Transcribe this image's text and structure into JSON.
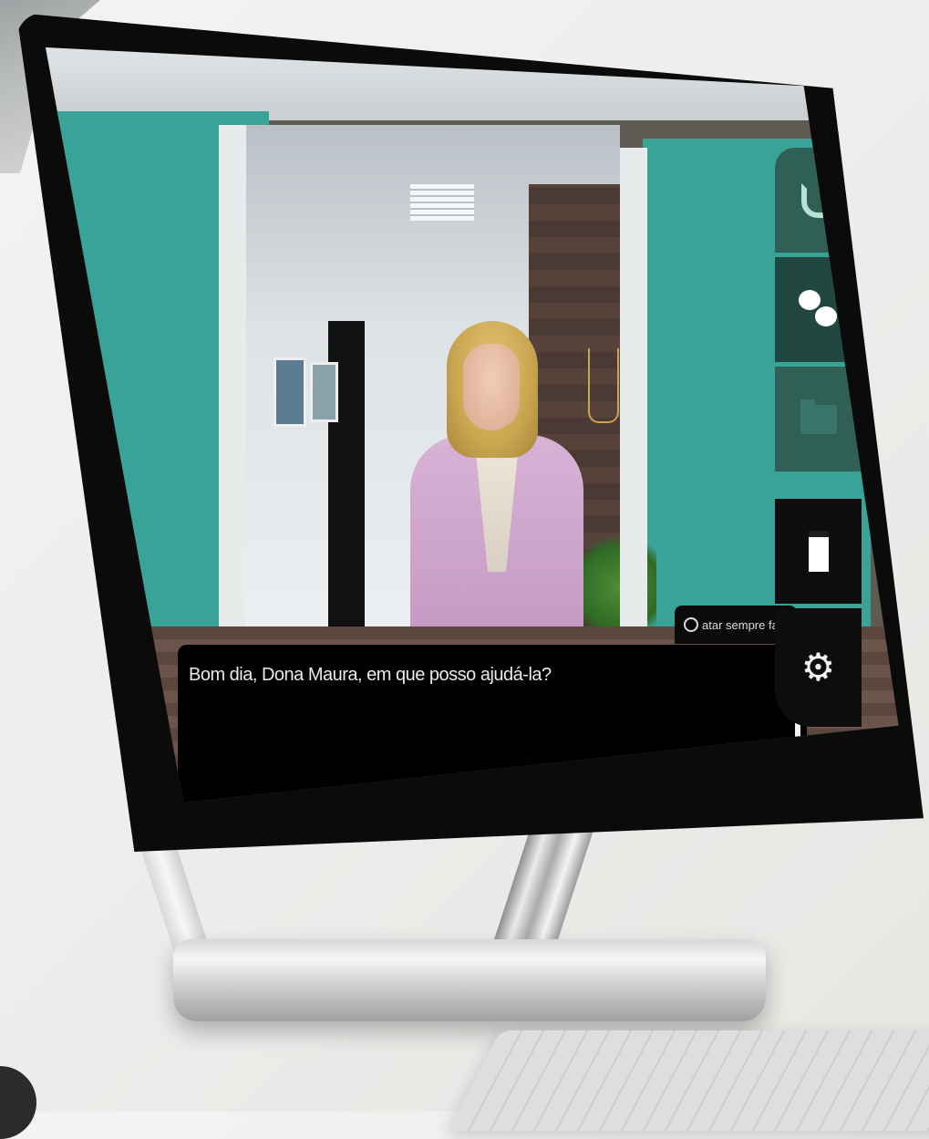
{
  "dialogue": {
    "text": "Bom dia, Dona Maura, em que posso ajudá-la?",
    "speaker_tag": "atar sempre fala"
  },
  "toolbar": {
    "buttons": [
      {
        "icon": "phone-icon"
      },
      {
        "icon": "chat-icon"
      },
      {
        "icon": "folder-icon"
      },
      {
        "icon": "card-icon"
      },
      {
        "icon": "gear-icon"
      }
    ]
  },
  "colors": {
    "wall": "#3aa397",
    "toolbar_green": "#2f5f55",
    "toolbar_dark_green": "#214840",
    "dialogue_bg": "#000000"
  }
}
